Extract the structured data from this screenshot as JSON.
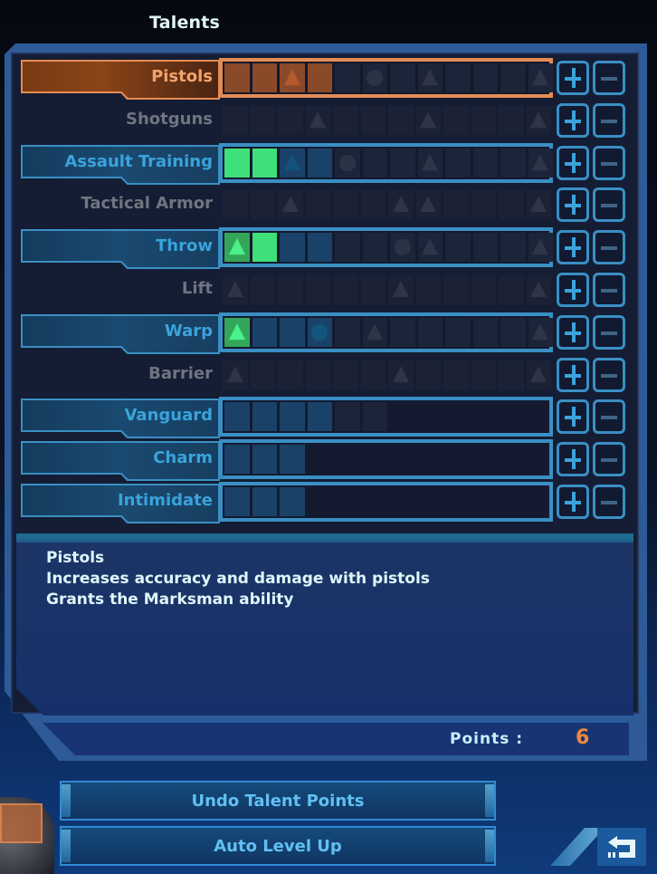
{
  "title": "Talents",
  "talents": [
    {
      "name": "Pistols",
      "state": "selected",
      "cells": [
        "fo",
        "fo",
        "fo:tri",
        "fo",
        "b",
        "b:circ",
        "b",
        "b:tri",
        "b",
        "b",
        "b",
        "b:tri"
      ]
    },
    {
      "name": "Shotguns",
      "state": "locked",
      "cells": [
        "b",
        "b",
        "b",
        "b:tri",
        "b",
        "b",
        "b",
        "b:tri",
        "b",
        "b",
        "b",
        "b:tri"
      ]
    },
    {
      "name": "Assault Training",
      "state": "unlocked",
      "cells": [
        "fg",
        "fg",
        "a:tri",
        "a",
        "b:circ",
        "b",
        "b",
        "b:tri",
        "b",
        "b",
        "b",
        "b:tri"
      ]
    },
    {
      "name": "Tactical Armor",
      "state": "locked",
      "cells": [
        "b",
        "b",
        "b:tri",
        "b",
        "b",
        "b",
        "b:tri",
        "b:tri",
        "b",
        "b",
        "b",
        "b:tri"
      ]
    },
    {
      "name": "Throw",
      "state": "unlocked",
      "cells": [
        "fgt:tri",
        "fg",
        "a",
        "a",
        "b",
        "b",
        "b:circ",
        "b:tri",
        "b",
        "b",
        "b",
        "b:tri"
      ]
    },
    {
      "name": "Lift",
      "state": "locked",
      "cells": [
        "b:tri",
        "b",
        "b",
        "b",
        "b",
        "b",
        "b:tri",
        "b",
        "b",
        "b",
        "b",
        "b:tri"
      ]
    },
    {
      "name": "Warp",
      "state": "unlocked",
      "cells": [
        "fgt:tri",
        "a",
        "a",
        "a:circ",
        "b",
        "b:tri",
        "b",
        "b",
        "b",
        "b",
        "b",
        "b:tri"
      ]
    },
    {
      "name": "Barrier",
      "state": "locked",
      "cells": [
        "b:tri",
        "b",
        "b",
        "b",
        "b",
        "b",
        "b:tri",
        "b",
        "b",
        "b",
        "b",
        "b:tri"
      ]
    },
    {
      "name": "Vanguard",
      "state": "unlocked",
      "cells": [
        "a",
        "a",
        "a",
        "a",
        "b",
        "b",
        "e",
        "e",
        "e",
        "e",
        "e",
        "e"
      ]
    },
    {
      "name": "Charm",
      "state": "unlocked",
      "cells": [
        "a",
        "a",
        "a",
        "e",
        "e",
        "e",
        "e",
        "e",
        "e",
        "e",
        "e",
        "e"
      ]
    },
    {
      "name": "Intimidate",
      "state": "unlocked",
      "cells": [
        "a",
        "a",
        "a",
        "e",
        "e",
        "e",
        "e",
        "e",
        "e",
        "e",
        "e",
        "e"
      ]
    }
  ],
  "description": {
    "name": "Pistols",
    "line1": "Increases accuracy and damage with pistols",
    "line2": "Grants the Marksman ability"
  },
  "points": {
    "label": "Points :",
    "value": "6"
  },
  "buttons": {
    "undo": "Undo Talent Points",
    "auto": "Auto Level Up",
    "back": "back-icon"
  },
  "colors": {
    "selected": "#e58c55",
    "unlocked": "#3a8fc4",
    "filled": "#3ee07a",
    "points": "#f0893e"
  }
}
